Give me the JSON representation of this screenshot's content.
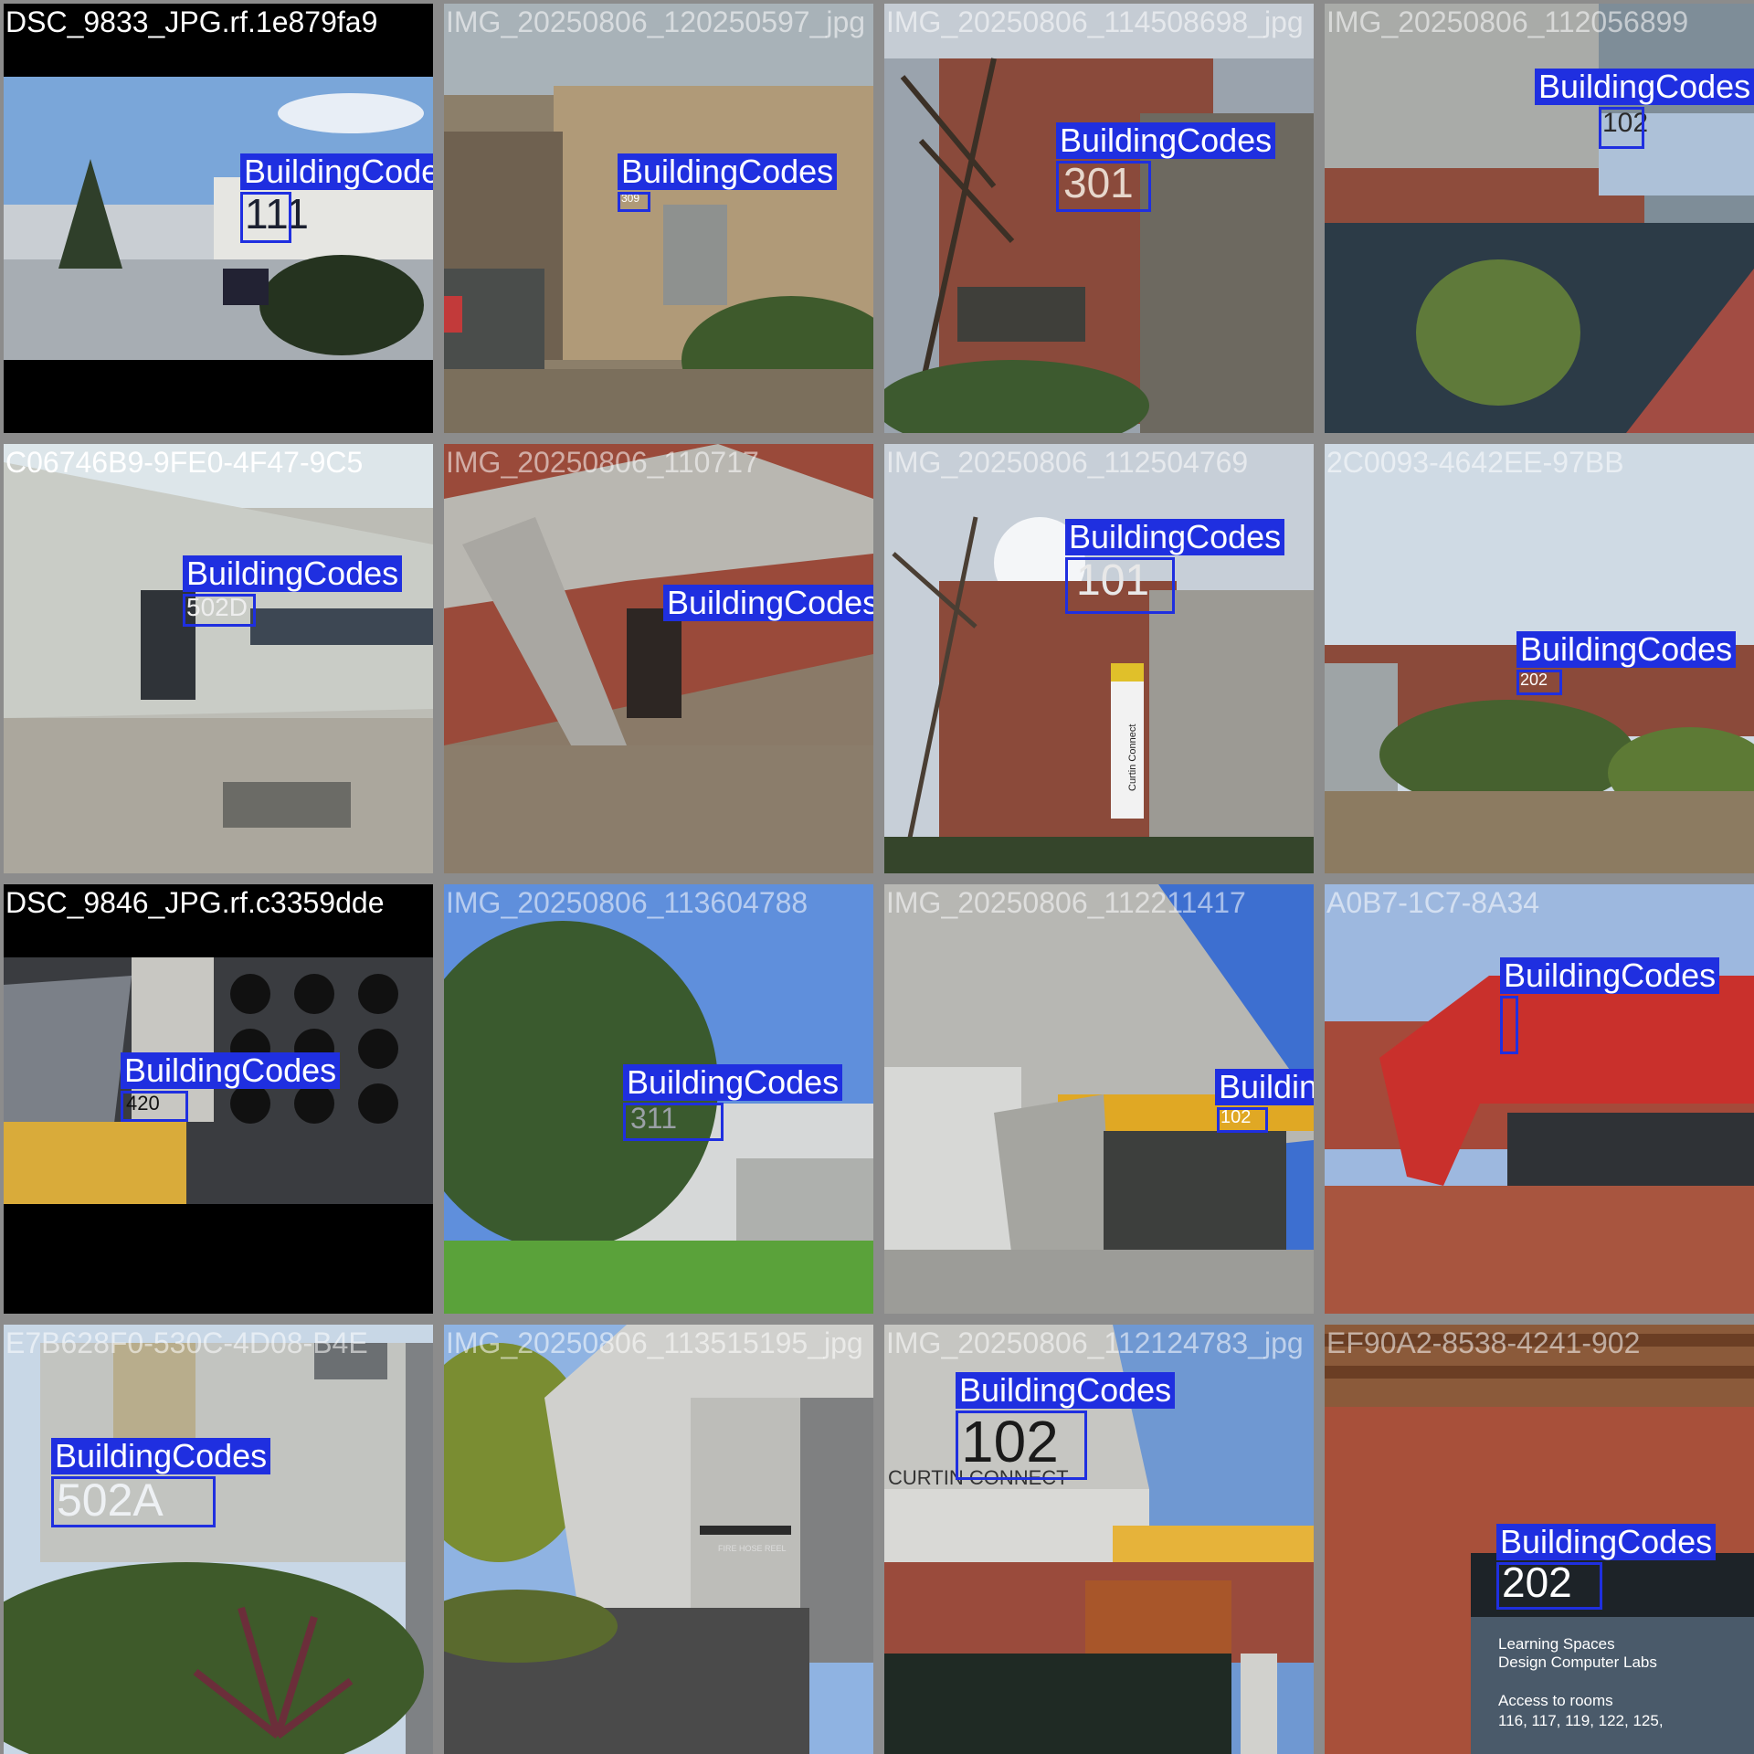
{
  "label_class": "BuildingCodes",
  "colors": {
    "box": "#1f2fe0",
    "label_text": "#ffffff",
    "tile_border": "#8c8c8c"
  },
  "tiles": [
    {
      "filename": "DSC_9833_JPG.rf.1e879fa9",
      "visible_code": "111"
    },
    {
      "filename": "IMG_20250806_120250597_jpg",
      "visible_code": "309"
    },
    {
      "filename": "IMG_20250806_114508698_jpg",
      "visible_code": "301"
    },
    {
      "filename": "IMG_20250806_112056899",
      "visible_code": "102"
    },
    {
      "filename": "C06746B9-9FE0-4F47-9C5",
      "visible_code": "502D"
    },
    {
      "filename": "IMG_20250806_110717",
      "visible_code": ""
    },
    {
      "filename": "IMG_20250806_112504769",
      "visible_code": "101"
    },
    {
      "filename": "2C0093-4642EE-97BB",
      "visible_code": "202"
    },
    {
      "filename": "DSC_9846_JPG.rf.c3359dde",
      "visible_code": "420"
    },
    {
      "filename": "IMG_20250806_113604788",
      "visible_code": "311"
    },
    {
      "filename": "IMG_20250806_112211417",
      "visible_code": "102"
    },
    {
      "filename": "A0B7-1C7-8A34",
      "visible_code": ""
    },
    {
      "filename": "E7B628F0-530C-4D08-B4E",
      "visible_code": "502A"
    },
    {
      "filename": "IMG_20250806_113515195_jpg",
      "visible_code": ""
    },
    {
      "filename": "IMG_20250806_112124783_jpg",
      "visible_code": "102"
    },
    {
      "filename": "EF90A2-8538-4241-902",
      "visible_code": "202"
    }
  ],
  "signs": {
    "curtin_connect_1": "CURTIN CONNECT",
    "curtin_connect_pole": "Curtin Connect",
    "fire_hose": "FIRE HOSE REEL",
    "labs_line1": "Learning Spaces",
    "labs_line2": "Design Computer Labs",
    "labs_line3": "Access to rooms",
    "labs_line4": "116, 117, 119, 122, 125,"
  }
}
